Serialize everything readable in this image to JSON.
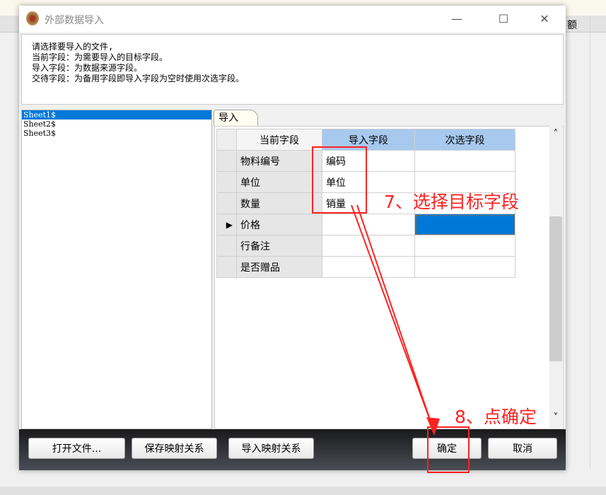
{
  "background": {
    "column_header": "额"
  },
  "dialog": {
    "title": "外部数据导入",
    "window_controls": {
      "minimize": "—",
      "maximize": "☐",
      "close": "✕"
    },
    "description": [
      "请选择要导入的文件,",
      "当前字段：为需要导入的目标字段。",
      "导入字段：为数据来源字段。",
      "交待字段：为备用字段即导入字段为空时使用次选字段。"
    ],
    "sheets": [
      {
        "name": "Sheet1$",
        "selected": true
      },
      {
        "name": "Sheet2$"
      },
      {
        "name": "Sheet3$"
      }
    ],
    "tab": "导入",
    "grid": {
      "headers": [
        "当前字段",
        "导入字段",
        "次选字段"
      ],
      "rows": [
        {
          "current": "物料编号",
          "import": "编码",
          "alt": ""
        },
        {
          "current": "单位",
          "import": "单位",
          "alt": ""
        },
        {
          "current": "数量",
          "import": "销量",
          "alt": ""
        },
        {
          "current": "价格",
          "import": "",
          "alt": "",
          "active": true
        },
        {
          "current": "行备注",
          "import": "",
          "alt": ""
        },
        {
          "current": "是否赠品",
          "import": "",
          "alt": ""
        }
      ],
      "active_marker": "▶",
      "scroll_up": "˄",
      "scroll_down": "˅"
    },
    "buttons": {
      "open_file": "打开文件...",
      "save_mapping": "保存映射关系",
      "import_mapping": "导入映射关系",
      "ok": "确定",
      "cancel": "取消"
    }
  },
  "annotations": {
    "step7": "7、选择目标字段",
    "step8": "8、点确定",
    "color": "#ff2222"
  }
}
